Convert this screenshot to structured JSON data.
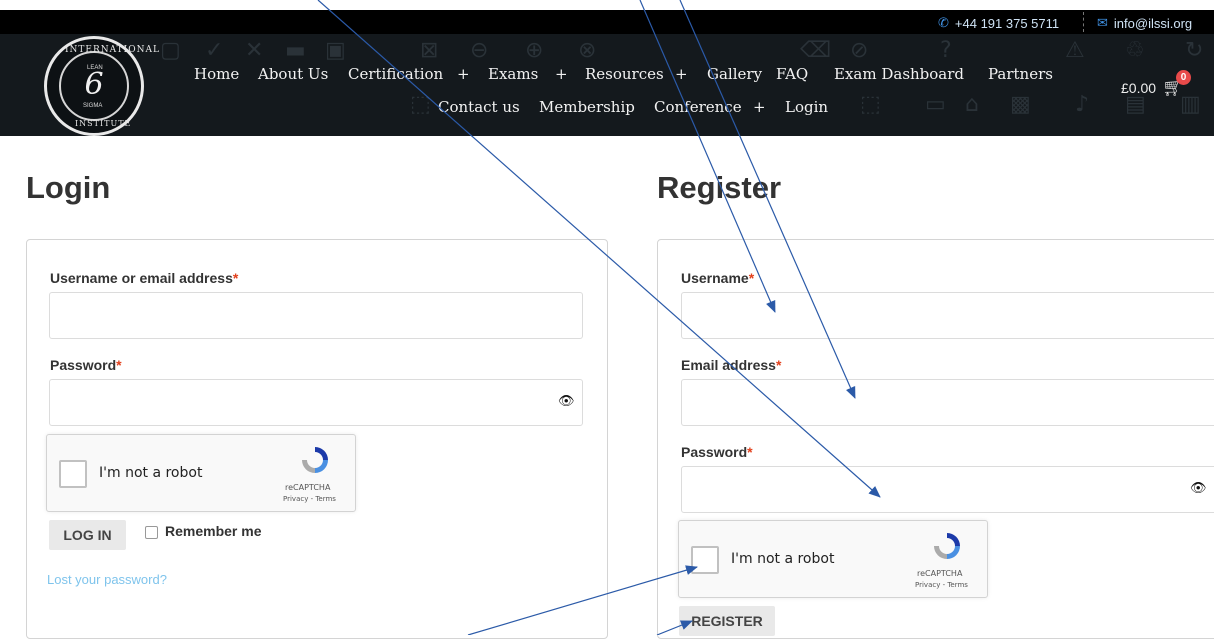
{
  "contact": {
    "phone": "+44 191 375 5711",
    "email": "info@ilssi.org"
  },
  "logo": {
    "top": "INTERNATIONAL",
    "bottom": "INSTITUTE",
    "lean": "LEAN",
    "six": "6",
    "sigma": "SIGMA"
  },
  "nav": {
    "row1": [
      "Home",
      "About Us",
      "Certification",
      "+",
      "Exams",
      "+",
      "Resources",
      "+",
      "Gallery",
      "FAQ",
      "Exam Dashboard",
      "Partners"
    ],
    "row2": [
      "Contact us",
      "Membership",
      "Conference",
      "+",
      "Login"
    ]
  },
  "cart": {
    "total": "£0.00",
    "count": "0"
  },
  "login": {
    "heading": "Login",
    "username_label": "Username or email address",
    "password_label": "Password",
    "required_mark": "*",
    "button": "LOG IN",
    "remember": "Remember me",
    "lost": "Lost your password?"
  },
  "register": {
    "heading": "Register",
    "username_label": "Username",
    "email_label": "Email address",
    "password_label": "Password",
    "required_mark": "*",
    "button": "REGISTER"
  },
  "captcha": {
    "label": "I'm not a robot",
    "brand": "reCAPTCHA",
    "links": "Privacy - Terms"
  },
  "colors": {
    "header": "#14191d",
    "accent_link": "#7fc4ec",
    "required": "#e2401c",
    "annotation": "#2b5aa8"
  }
}
